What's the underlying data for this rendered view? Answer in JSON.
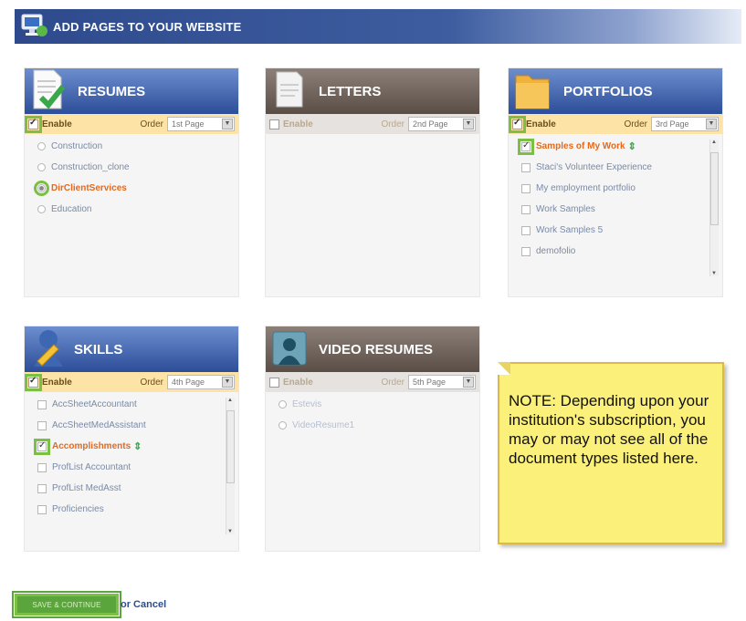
{
  "header": {
    "title": "ADD PAGES TO YOUR WEBSITE",
    "icon": "computer-icon"
  },
  "panels": {
    "resumes": {
      "title": "RESUMES",
      "enable_label": "Enable",
      "order_label": "Order",
      "order_value": "1st Page",
      "items": [
        "Construction",
        "Construction_clone",
        "DirClientServices",
        "Education"
      ]
    },
    "letters": {
      "title": "LETTERS",
      "enable_label": "Enable",
      "order_label": "Order",
      "order_value": "2nd Page"
    },
    "portfolios": {
      "title": "PORTFOLIOS",
      "enable_label": "Enable",
      "order_label": "Order",
      "order_value": "3rd Page",
      "items": [
        "Samples of My Work",
        "Staci's Volunteer Experience",
        "My employment portfolio",
        "Work Samples",
        "Work Samples 5",
        "demofolio"
      ]
    },
    "skills": {
      "title": "SKILLS",
      "enable_label": "Enable",
      "order_label": "Order",
      "order_value": "4th Page",
      "items": [
        "AccSheetAccountant",
        "AccSheetMedAssistant",
        "Accomplishments",
        "ProfList Accountant",
        "ProfList MedAsst",
        "Proficiencies"
      ]
    },
    "video_resumes": {
      "title": "VIDEO RESUMES",
      "enable_label": "Enable",
      "order_label": "Order",
      "order_value": "5th Page",
      "items": [
        "Estevis",
        "VideoResume1"
      ]
    }
  },
  "note": {
    "text": "NOTE:  Depending upon your institution's subscription, you may or may not see all of the document types listed here."
  },
  "footer": {
    "save_label": "SAVE & CONTINUE",
    "or_cancel_label": "or Cancel"
  },
  "colors": {
    "header_blue": "#2e4a8c",
    "highlight_green": "#7cc043",
    "active_orange": "#e26a1f",
    "note_yellow": "#fbf07a"
  }
}
